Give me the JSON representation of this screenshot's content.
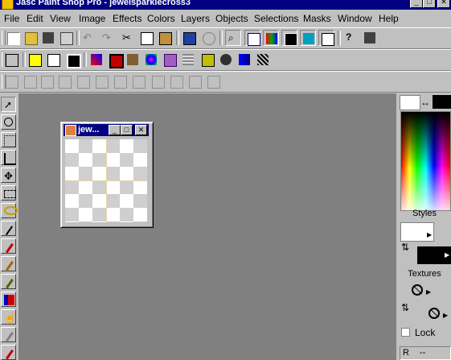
{
  "window": {
    "title": "Jasc Paint Shop Pro - jewelsparklecross3"
  },
  "menu": [
    "File",
    "Edit",
    "View",
    "Image",
    "Effects",
    "Colors",
    "Layers",
    "Objects",
    "Selections",
    "Masks",
    "Window",
    "Help"
  ],
  "child_window": {
    "title": "jew..."
  },
  "right_panel": {
    "swap_glyph": "↔",
    "styles_label": "Styles",
    "textures_label": "Textures",
    "lock_label": "Lock",
    "color_readout_label": "R",
    "color_readout_value": "--"
  },
  "colors": {
    "titlebar": "#000080",
    "workspace": "#808080",
    "fg_swatch": "#ffffff",
    "bg_swatch": "#000000"
  },
  "standard_toolbar_icons": [
    "new-icon",
    "open-icon",
    "save-icon",
    "print-icon",
    "undo-icon",
    "redo-icon",
    "cut-icon",
    "copy-icon",
    "paste-icon",
    "full-screen-preview-icon",
    "browse-icon",
    "zoom-icon",
    "overview-icon",
    "tool-options-icon",
    "color-palette-icon",
    "layer-palette-icon",
    "histogram-icon",
    "context-help-icon",
    "lock-icon"
  ],
  "effects_toolbar_icons": [
    "effects-browser-icon",
    "yellow-swatch-icon",
    "drop-shadow-icon",
    "inner-bevel-icon",
    "buttonize-icon",
    "cutout-icon",
    "frame-icon",
    "kaleidoscope-icon",
    "texture-icon",
    "blinds-icon",
    "mosaic-icon",
    "sculpture-icon",
    "gradient-icon",
    "weave-icon"
  ],
  "layers_toolbar_icons": [
    "new-layer-icon",
    "delete-layer-icon",
    "duplicate-layer-icon",
    "merge-layer-icon",
    "layer-properties-icon",
    "promote-selection-icon",
    "mask-icon",
    "group-icon",
    "layer-visibility-icon",
    "link-layer-icon",
    "lock-transparency-icon"
  ],
  "tools": [
    "arrow-tool-icon",
    "zoom-tool-icon",
    "deform-tool-icon",
    "crop-tool-icon",
    "mover-tool-icon",
    "selection-tool-icon",
    "freehand-selection-icon",
    "magic-wand-icon",
    "dropper-tool-icon",
    "paint-brush-icon",
    "clone-brush-icon",
    "color-replacer-icon",
    "retouch-tool-icon",
    "eraser-tool-icon",
    "picture-tube-icon",
    "airbrush-icon"
  ]
}
